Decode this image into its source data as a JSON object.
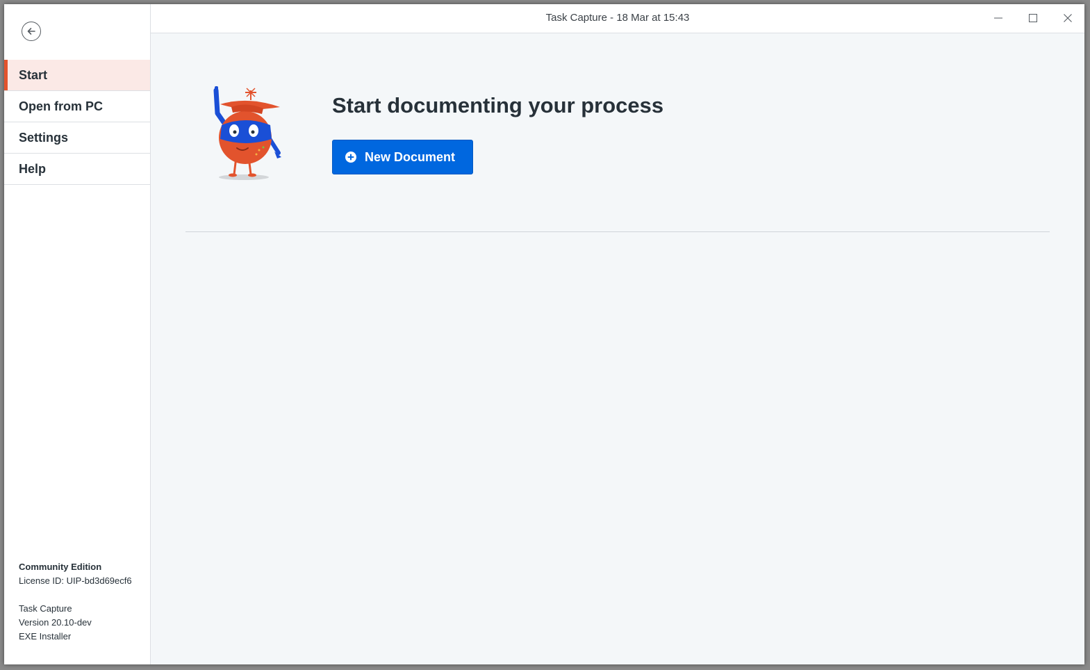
{
  "window": {
    "title": "Task Capture - 18 Mar at 15:43"
  },
  "sidebar": {
    "back_icon": "arrow-left-circle-icon",
    "items": [
      {
        "label": "Start",
        "active": true
      },
      {
        "label": "Open from PC",
        "active": false
      },
      {
        "label": "Settings",
        "active": false
      },
      {
        "label": "Help",
        "active": false
      }
    ],
    "footer": {
      "edition": "Community Edition",
      "license": "License ID: UIP-bd3d69ecf6",
      "product": "Task Capture",
      "version": "Version 20.10-dev",
      "installer": "EXE Installer"
    }
  },
  "main": {
    "heading": "Start documenting your process",
    "new_document_label": "New Document",
    "new_document_icon": "plus-circle-icon",
    "mascot_icon": "robot-mascot-icon"
  },
  "colors": {
    "accent": "#e2532d",
    "primary_button": "#0067df",
    "active_nav_bg": "#fbe9e6",
    "text": "#273139"
  }
}
